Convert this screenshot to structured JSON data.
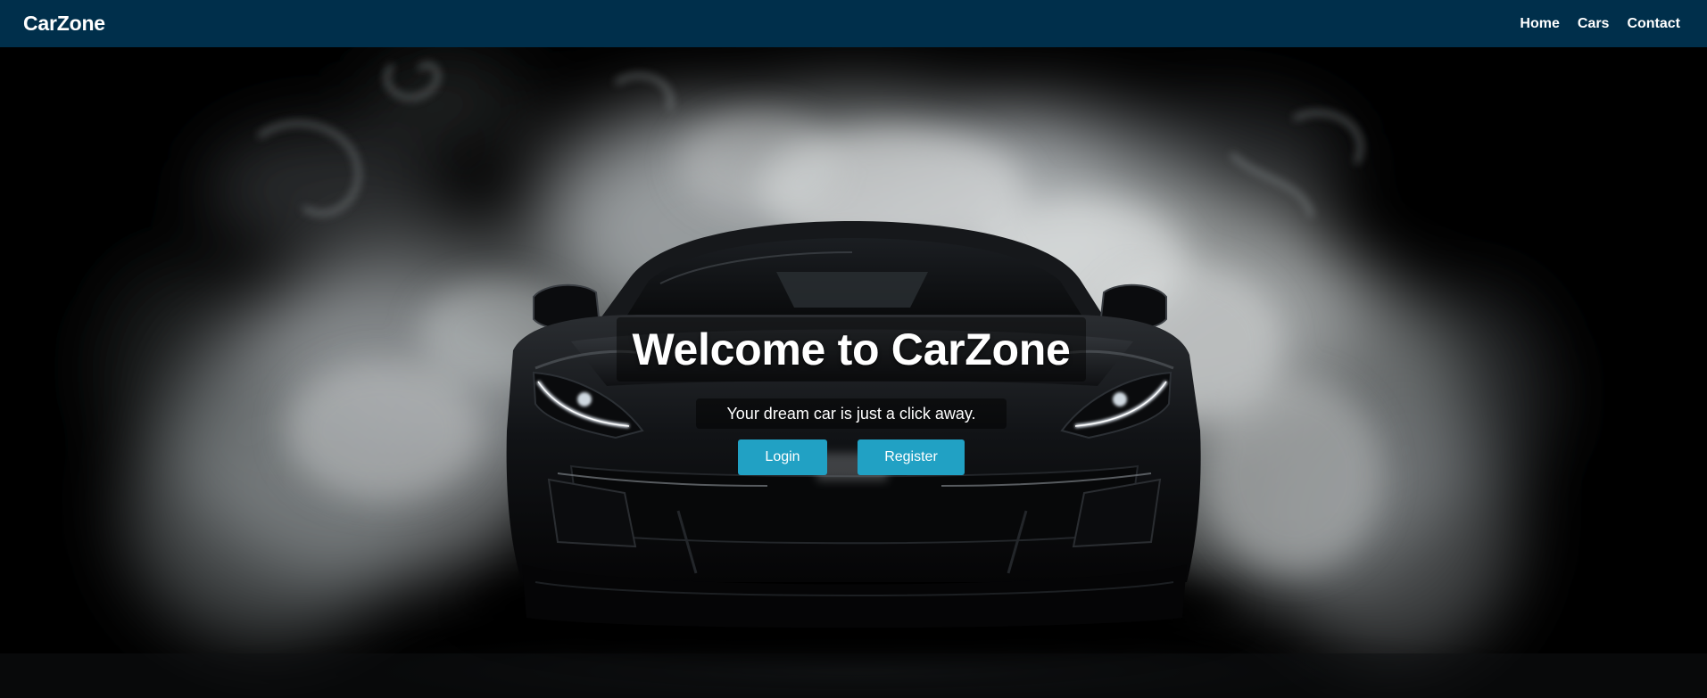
{
  "navbar": {
    "brand": "CarZone",
    "links": [
      {
        "label": "Home"
      },
      {
        "label": "Cars"
      },
      {
        "label": "Contact"
      }
    ]
  },
  "hero": {
    "title": "Welcome to CarZone",
    "subtitle": "Your dream car is just a click away.",
    "buttons": {
      "login_label": "Login",
      "register_label": "Register"
    },
    "background_image": "black sports car surrounded by white smoke"
  },
  "colors": {
    "navbar_bg": "#002f4b",
    "button_bg": "#21a1c4",
    "text": "#ffffff",
    "hero_bg": "#000000"
  }
}
